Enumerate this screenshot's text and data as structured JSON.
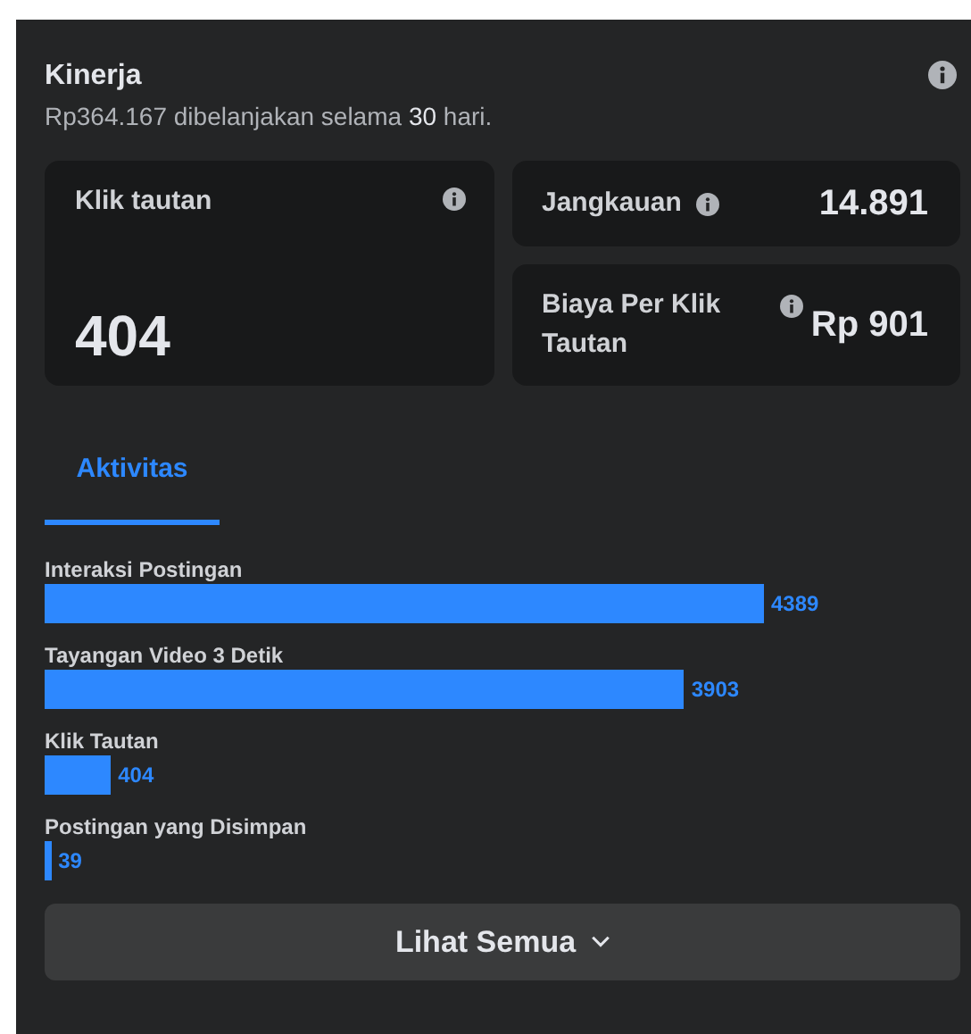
{
  "panel": {
    "title": "Kinerja",
    "subtitle_parts": [
      "Rp364.167 dibelanjakan selama ",
      "30",
      " hari."
    ]
  },
  "metrics": [
    {
      "kind": "large",
      "label": "Klik tautan",
      "value": "404"
    },
    {
      "kind": "compact",
      "label": "Jangkauan",
      "value": "14.891"
    },
    {
      "kind": "compact",
      "label": "Biaya Per Klik Tautan",
      "value": "Rp 901"
    }
  ],
  "tabs": [
    {
      "label": "Aktivitas",
      "selected": true
    }
  ],
  "activity": {
    "chart_data": {
      "type": "bar",
      "orientation": "horizontal",
      "data_labels": true,
      "categories": [
        "Interaksi Postingan",
        "Tayangan Video 3 Detik",
        "Klik Tautan",
        "Postingan yang Disimpan"
      ],
      "series": [
        {
          "color": "#2d88ff",
          "values": [
            4389,
            3903,
            404,
            39
          ]
        }
      ]
    }
  },
  "see_all_button": {
    "label": "Lihat Semua"
  }
}
